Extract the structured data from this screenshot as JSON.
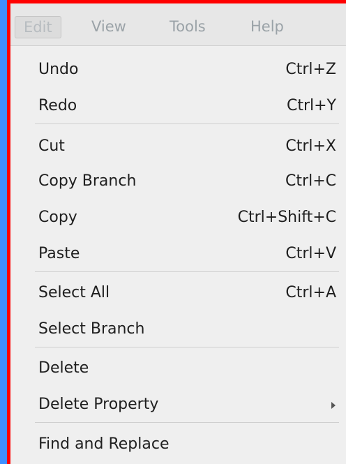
{
  "menubar": {
    "items": [
      "Edit",
      "View",
      "Tools",
      "Help"
    ]
  },
  "menu": {
    "items": [
      {
        "label": "Undo",
        "shortcut": "Ctrl+Z"
      },
      {
        "label": "Redo",
        "shortcut": "Ctrl+Y"
      },
      {
        "label": "Cut",
        "shortcut": "Ctrl+X"
      },
      {
        "label": "Copy Branch",
        "shortcut": "Ctrl+C"
      },
      {
        "label": "Copy",
        "shortcut": "Ctrl+Shift+C"
      },
      {
        "label": "Paste",
        "shortcut": "Ctrl+V"
      },
      {
        "label": "Select All",
        "shortcut": "Ctrl+A"
      },
      {
        "label": "Select Branch",
        "shortcut": ""
      },
      {
        "label": "Delete",
        "shortcut": ""
      },
      {
        "label": "Delete Property",
        "shortcut": "",
        "submenu_icon": "chevron-right-icon"
      },
      {
        "label": "Find and Replace",
        "shortcut": ""
      }
    ]
  },
  "colors": {
    "background": "#3f8fff",
    "window_border": "#ff0000",
    "menu_background": "#efefef",
    "menubar_background": "#e7e7e7",
    "text": "#1f1f1f"
  }
}
